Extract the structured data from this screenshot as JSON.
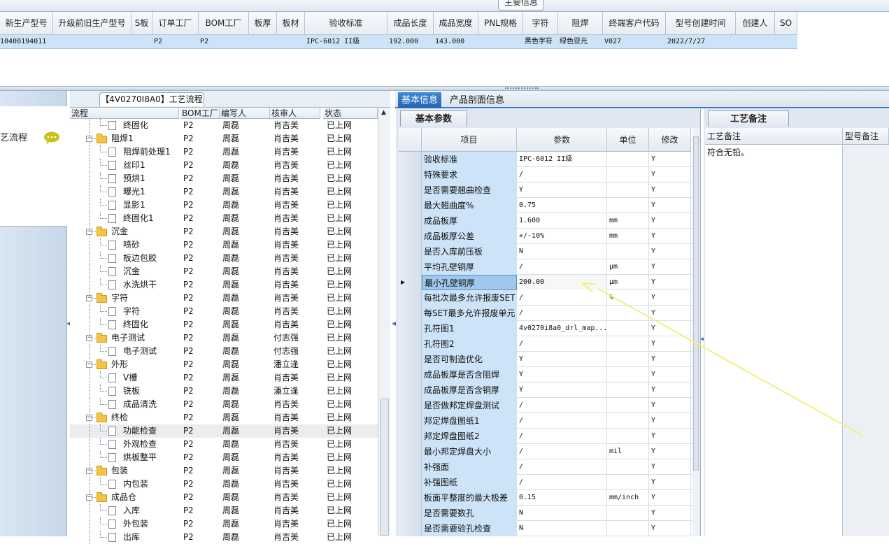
{
  "main_tab": "主要信息",
  "main_grid": {
    "headers": [
      "新生产型号",
      "升级前旧生产型号",
      "S板",
      "订单工厂",
      "BOM工厂",
      "板厚",
      "板材",
      "验收标准",
      "成品长度",
      "成品宽度",
      "PNL规格",
      "字符",
      "阻焊",
      "终端客户代码",
      "型号创建时间",
      "创建人",
      "SO"
    ],
    "row": [
      "10400194011",
      "",
      "",
      "P2",
      "P2",
      "",
      "",
      "IPC-6012 II级",
      "192.000",
      "143.000",
      "",
      "黑色字符",
      "绿色亚光",
      "V027",
      "2022/7/27",
      "",
      ""
    ]
  },
  "left_nav": {
    "label": "艺流程",
    "icon": "chat-bubble-icon"
  },
  "process_panel": {
    "title": "【4V0270I8A0】工艺流程",
    "headers": [
      "流程",
      "BOM工厂",
      "编写人",
      "核审人",
      "状态"
    ],
    "rows": [
      {
        "name": "终固化",
        "level": 1,
        "folder": false,
        "bom": "P2",
        "writer": "周磊",
        "reviewer": "肖吉美",
        "status": "已上网"
      },
      {
        "name": "阻焊1",
        "level": 0,
        "folder": true,
        "bom": "P2",
        "writer": "周磊",
        "reviewer": "肖吉美",
        "status": "已上网"
      },
      {
        "name": "阻焊前处理1",
        "level": 1,
        "folder": false,
        "bom": "P2",
        "writer": "周磊",
        "reviewer": "肖吉美",
        "status": "已上网"
      },
      {
        "name": "丝印1",
        "level": 1,
        "folder": false,
        "bom": "P2",
        "writer": "周磊",
        "reviewer": "肖吉美",
        "status": "已上网"
      },
      {
        "name": "预烘1",
        "level": 1,
        "folder": false,
        "bom": "P2",
        "writer": "周磊",
        "reviewer": "肖吉美",
        "status": "已上网"
      },
      {
        "name": "曝光1",
        "level": 1,
        "folder": false,
        "bom": "P2",
        "writer": "周磊",
        "reviewer": "肖吉美",
        "status": "已上网"
      },
      {
        "name": "显影1",
        "level": 1,
        "folder": false,
        "bom": "P2",
        "writer": "周磊",
        "reviewer": "肖吉美",
        "status": "已上网"
      },
      {
        "name": "终固化1",
        "level": 1,
        "folder": false,
        "bom": "P2",
        "writer": "周磊",
        "reviewer": "肖吉美",
        "status": "已上网"
      },
      {
        "name": "沉金",
        "level": 0,
        "folder": true,
        "bom": "P2",
        "writer": "周磊",
        "reviewer": "肖吉美",
        "status": "已上网"
      },
      {
        "name": "喷砂",
        "level": 1,
        "folder": false,
        "bom": "P2",
        "writer": "周磊",
        "reviewer": "肖吉美",
        "status": "已上网"
      },
      {
        "name": "板边包胶",
        "level": 1,
        "folder": false,
        "bom": "P2",
        "writer": "周磊",
        "reviewer": "肖吉美",
        "status": "已上网"
      },
      {
        "name": "沉金",
        "level": 1,
        "folder": false,
        "bom": "P2",
        "writer": "周磊",
        "reviewer": "肖吉美",
        "status": "已上网"
      },
      {
        "name": "水洗烘干",
        "level": 1,
        "folder": false,
        "bom": "P2",
        "writer": "周磊",
        "reviewer": "肖吉美",
        "status": "已上网"
      },
      {
        "name": "字符",
        "level": 0,
        "folder": true,
        "bom": "P2",
        "writer": "周磊",
        "reviewer": "肖吉美",
        "status": "已上网"
      },
      {
        "name": "字符",
        "level": 1,
        "folder": false,
        "bom": "P2",
        "writer": "周磊",
        "reviewer": "肖吉美",
        "status": "已上网"
      },
      {
        "name": "终固化",
        "level": 1,
        "folder": false,
        "bom": "P2",
        "writer": "周磊",
        "reviewer": "肖吉美",
        "status": "已上网"
      },
      {
        "name": "电子测试",
        "level": 0,
        "folder": true,
        "bom": "P2",
        "writer": "周磊",
        "reviewer": "付志强",
        "status": "已上网"
      },
      {
        "name": "电子测试",
        "level": 1,
        "folder": false,
        "bom": "P2",
        "writer": "周磊",
        "reviewer": "付志强",
        "status": "已上网"
      },
      {
        "name": "外形",
        "level": 0,
        "folder": true,
        "bom": "P2",
        "writer": "周磊",
        "reviewer": "潘立逢",
        "status": "已上网"
      },
      {
        "name": "V槽",
        "level": 1,
        "folder": false,
        "bom": "P2",
        "writer": "周磊",
        "reviewer": "肖吉美",
        "status": "已上网"
      },
      {
        "name": "铣板",
        "level": 1,
        "folder": false,
        "bom": "P2",
        "writer": "周磊",
        "reviewer": "潘立逢",
        "status": "已上网"
      },
      {
        "name": "成品清洗",
        "level": 1,
        "folder": false,
        "bom": "P2",
        "writer": "周磊",
        "reviewer": "肖吉美",
        "status": "已上网"
      },
      {
        "name": "终检",
        "level": 0,
        "folder": true,
        "bom": "P2",
        "writer": "周磊",
        "reviewer": "肖吉美",
        "status": "已上网"
      },
      {
        "name": "功能检查",
        "level": 1,
        "folder": false,
        "bom": "P2",
        "writer": "周磊",
        "reviewer": "肖吉美",
        "status": "已上网"
      },
      {
        "name": "外观检查",
        "level": 1,
        "folder": false,
        "bom": "P2",
        "writer": "周磊",
        "reviewer": "肖吉美",
        "status": "已上网"
      },
      {
        "name": "烘板整平",
        "level": 1,
        "folder": false,
        "bom": "P2",
        "writer": "周磊",
        "reviewer": "肖吉美",
        "status": "已上网"
      },
      {
        "name": "包装",
        "level": 0,
        "folder": true,
        "bom": "P2",
        "writer": "周磊",
        "reviewer": "肖吉美",
        "status": "已上网"
      },
      {
        "name": "内包装",
        "level": 1,
        "folder": false,
        "bom": "P2",
        "writer": "周磊",
        "reviewer": "肖吉美",
        "status": "已上网"
      },
      {
        "name": "成品仓",
        "level": 0,
        "folder": true,
        "bom": "P2",
        "writer": "周磊",
        "reviewer": "肖吉美",
        "status": "已上网"
      },
      {
        "name": "入库",
        "level": 1,
        "folder": false,
        "bom": "P2",
        "writer": "周磊",
        "reviewer": "肖吉美",
        "status": "已上网"
      },
      {
        "name": "外包装",
        "level": 1,
        "folder": false,
        "bom": "P2",
        "writer": "周磊",
        "reviewer": "肖吉美",
        "status": "已上网"
      },
      {
        "name": "出库",
        "level": 1,
        "folder": false,
        "bom": "P2",
        "writer": "周磊",
        "reviewer": "肖吉美",
        "status": "已上网"
      }
    ],
    "selected_index": 23
  },
  "right_tabs": [
    "基本信息",
    "产品剖面信息"
  ],
  "params": {
    "section": "基本参数",
    "headers": [
      "项目",
      "参数",
      "单位",
      "修改"
    ],
    "rows": [
      {
        "item": "验收标准",
        "param": "IPC-6012 II级",
        "unit": "",
        "edit": "Y"
      },
      {
        "item": "特殊要求",
        "param": "/",
        "unit": "",
        "edit": "Y"
      },
      {
        "item": "是否需要翘曲检查",
        "param": "Y",
        "unit": "",
        "edit": "Y"
      },
      {
        "item": "最大翘曲度%",
        "param": "0.75",
        "unit": "",
        "edit": "Y"
      },
      {
        "item": "成品板厚",
        "param": "1.600",
        "unit": "mm",
        "edit": "Y"
      },
      {
        "item": "成品板厚公差",
        "param": "+/-10%",
        "unit": "mm",
        "edit": "Y"
      },
      {
        "item": "是否入库前压板",
        "param": "N",
        "unit": "",
        "edit": "Y"
      },
      {
        "item": "平均孔壁铜厚",
        "param": "/",
        "unit": "μm",
        "edit": "Y"
      },
      {
        "item": "最小孔壁铜厚",
        "param": "200.00",
        "unit": "μm",
        "edit": "Y"
      },
      {
        "item": "每批次最多允许报废SET",
        "param": "/",
        "unit": "%",
        "edit": "Y"
      },
      {
        "item": "每SET最多允许报废单元",
        "param": "/",
        "unit": "",
        "edit": "Y"
      },
      {
        "item": "孔符图1",
        "param": "4v0270i8a0_drl_map...",
        "unit": "",
        "edit": "Y"
      },
      {
        "item": "孔符图2",
        "param": "/",
        "unit": "",
        "edit": "Y"
      },
      {
        "item": "是否可制造优化",
        "param": "Y",
        "unit": "",
        "edit": "Y"
      },
      {
        "item": "成品板厚是否含阻焊",
        "param": "Y",
        "unit": "",
        "edit": "Y"
      },
      {
        "item": "成品板厚是否含铜厚",
        "param": "Y",
        "unit": "",
        "edit": "Y"
      },
      {
        "item": "是否做邦定焊盘测试",
        "param": "/",
        "unit": "",
        "edit": "Y"
      },
      {
        "item": "邦定焊盘图纸1",
        "param": "/",
        "unit": "",
        "edit": "Y"
      },
      {
        "item": "邦定焊盘图纸2",
        "param": "/",
        "unit": "",
        "edit": "Y"
      },
      {
        "item": "最小邦定焊盘大小",
        "param": "/",
        "unit": "mil",
        "edit": "Y"
      },
      {
        "item": "补强面",
        "param": "/",
        "unit": "",
        "edit": "Y"
      },
      {
        "item": "补强图纸",
        "param": "/",
        "unit": "",
        "edit": "Y"
      },
      {
        "item": "板面平整度的最大极差",
        "param": "0.15",
        "unit": "mm/inch",
        "edit": "Y"
      },
      {
        "item": "是否需要数孔",
        "param": "N",
        "unit": "",
        "edit": "Y"
      },
      {
        "item": "是否需要验孔检查",
        "param": "N",
        "unit": "",
        "edit": "Y"
      }
    ],
    "current_index": 8
  },
  "remarks": {
    "section": "工艺备注",
    "headers": [
      "工艺备注",
      "型号备注"
    ],
    "text": "符合无铅。"
  },
  "colors": {
    "accent": "#2a6fc0",
    "selection": "#cde3f7",
    "annotation": "#f4f07a"
  }
}
